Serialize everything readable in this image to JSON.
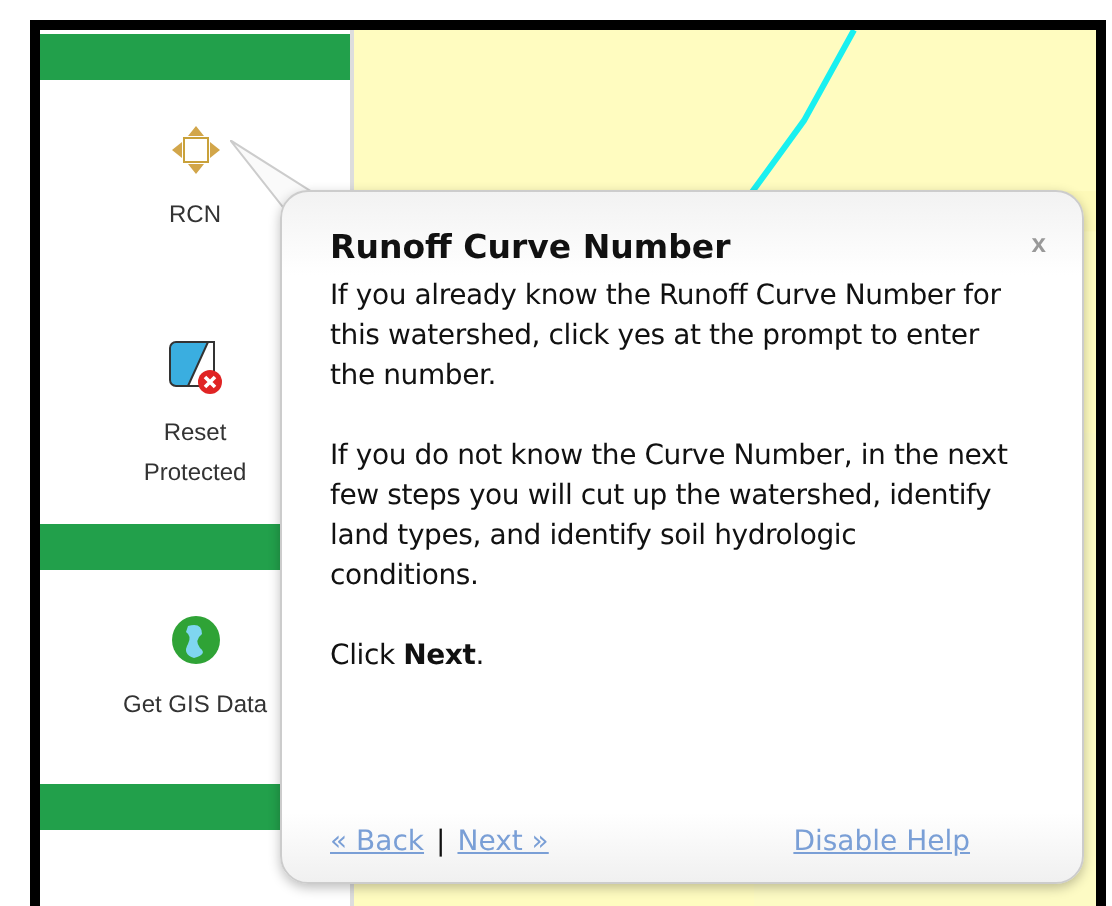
{
  "sidebar": {
    "items": [
      {
        "kind": "divider"
      },
      {
        "kind": "move",
        "label": "RCN"
      },
      {
        "kind": "reset",
        "label": "Reset Protected"
      },
      {
        "kind": "divider"
      },
      {
        "kind": "globe",
        "label": "Get GIS Data"
      },
      {
        "kind": "divider"
      }
    ]
  },
  "help_popup": {
    "title": "Runoff Curve Number",
    "close": "x",
    "paragraphs": [
      "If you already know the Runoff Curve Number for this watershed, click yes at the prompt to enter the number.",
      "If you do not know the Curve Number, in the next few steps you will cut up the watershed, identify land types, and identify soil hydrologic conditions.",
      "Click **Next**."
    ],
    "links": {
      "back": "« Back",
      "separator": "|",
      "next": "Next »",
      "disable": "Disable Help"
    }
  }
}
